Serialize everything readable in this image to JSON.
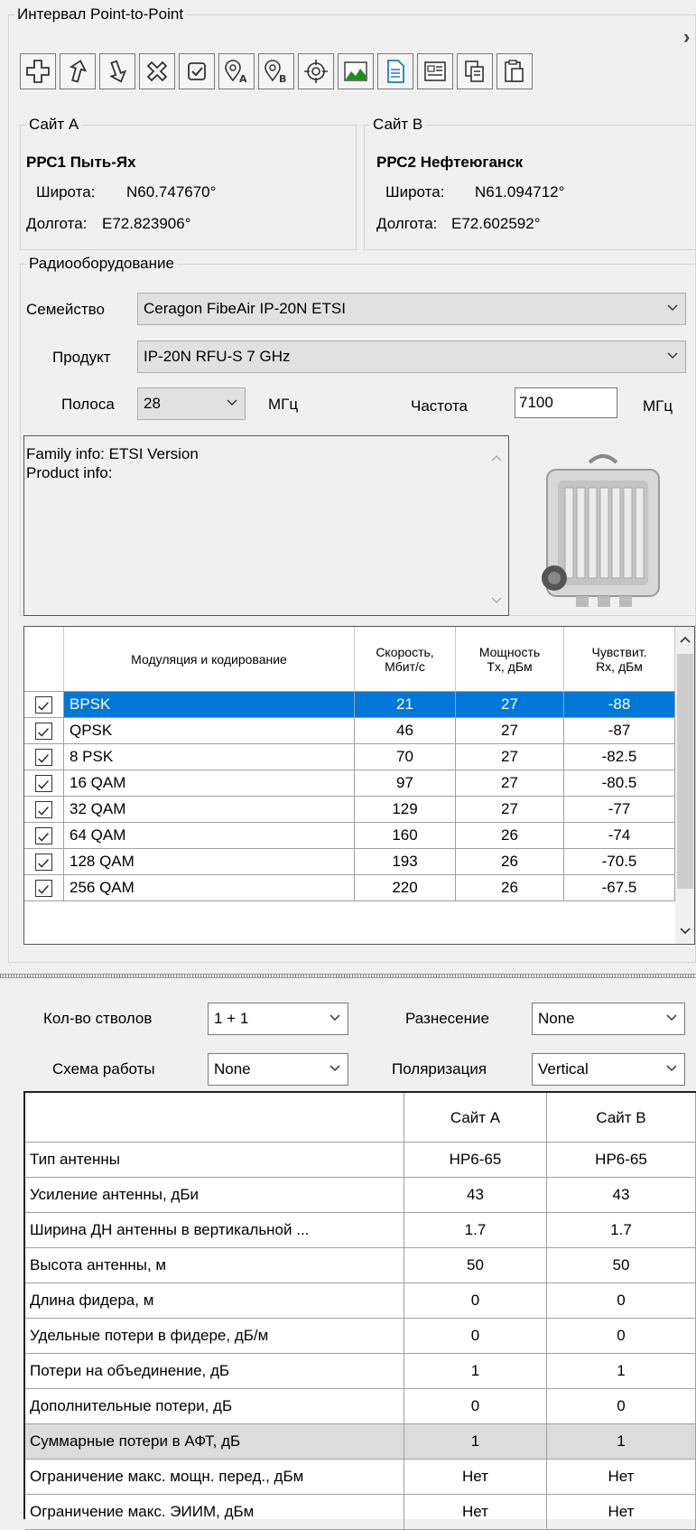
{
  "panel": {
    "title": "Интервал Point-to-Point",
    "collapse_glyph": "›"
  },
  "toolbar": {
    "buttons": [
      {
        "name": "add-icon"
      },
      {
        "name": "move-up-icon"
      },
      {
        "name": "move-down-icon"
      },
      {
        "name": "delete-icon"
      },
      {
        "name": "check-icon"
      },
      {
        "name": "site-a-pin-icon"
      },
      {
        "name": "site-b-pin-icon"
      },
      {
        "name": "target-icon"
      },
      {
        "name": "profile-chart-icon"
      },
      {
        "name": "document-icon"
      },
      {
        "name": "report-icon"
      },
      {
        "name": "copy-icon"
      },
      {
        "name": "paste-icon"
      }
    ]
  },
  "site_a": {
    "legend": "Сайт А",
    "name": "РРС1 Пыть-Ях",
    "lat_label": "Широта:",
    "lat_value": "N60.747670°",
    "lon_label": "Долгота:",
    "lon_value": "E72.823906°"
  },
  "site_b": {
    "legend": "Сайт В",
    "name": "РРС2 Нефтеюганск",
    "lat_label": "Широта:",
    "lat_value": "N61.094712°",
    "lon_label": "Долгота:",
    "lon_value": "E72.602592°"
  },
  "radio": {
    "legend": "Радиооборудование",
    "family_label": "Семейство",
    "family_value": "Ceragon FibeAir IP-20N ETSI",
    "product_label": "Продукт",
    "product_value": "IP-20N RFU-S 7 GHz",
    "band_label": "Полоса",
    "band_value": "28",
    "band_unit": "МГц",
    "freq_label": "Частота",
    "freq_value": "7100",
    "freq_unit": "МГц",
    "info_line1": "Family info: ETSI Version",
    "info_line2": "Product info:"
  },
  "modulation_table": {
    "headers": {
      "mod": "Модуляция и кодирование",
      "speed1": "Скорость,",
      "speed2": "Мбит/с",
      "power1": "Мощность",
      "power2": "Tx, дБм",
      "sens1": "Чувствит.",
      "sens2": "Rx, дБм"
    },
    "rows": [
      {
        "mod": "BPSK",
        "speed": "21",
        "power": "27",
        "sens": "-88",
        "checked": true,
        "selected": true
      },
      {
        "mod": "QPSK",
        "speed": "46",
        "power": "27",
        "sens": "-87",
        "checked": true
      },
      {
        "mod": "8 PSK",
        "speed": "70",
        "power": "27",
        "sens": "-82.5",
        "checked": true
      },
      {
        "mod": "16 QAM",
        "speed": "97",
        "power": "27",
        "sens": "-80.5",
        "checked": true
      },
      {
        "mod": "32 QAM",
        "speed": "129",
        "power": "27",
        "sens": "-77",
        "checked": true
      },
      {
        "mod": "64 QAM",
        "speed": "160",
        "power": "26",
        "sens": "-74",
        "checked": true
      },
      {
        "mod": "128 QAM",
        "speed": "193",
        "power": "26",
        "sens": "-70.5",
        "checked": true
      },
      {
        "mod": "256 QAM",
        "speed": "220",
        "power": "26",
        "sens": "-67.5",
        "checked": true
      }
    ]
  },
  "config": {
    "trunks_label": "Кол-во стволов",
    "trunks_value": "1 + 1",
    "diversity_label": "Разнесение",
    "diversity_value": "None",
    "scheme_label": "Схема работы",
    "scheme_value": "None",
    "polarization_label": "Поляризация",
    "polarization_value": "Vertical"
  },
  "antenna_table": {
    "headers": {
      "param": "",
      "site_a": "Сайт А",
      "site_b": "Сайт В"
    },
    "rows": [
      {
        "param": "Тип антенны",
        "a": "HP6-65",
        "b": "HP6-65"
      },
      {
        "param": "Усиление антенны, дБи",
        "a": "43",
        "b": "43"
      },
      {
        "param": "Ширина ДН антенны в вертикальной ...",
        "a": "1.7",
        "b": "1.7"
      },
      {
        "param": "Высота антенны, м",
        "a": "50",
        "b": "50"
      },
      {
        "param": "Длина фидера, м",
        "a": "0",
        "b": "0"
      },
      {
        "param": "Удельные потери в фидере, дБ/м",
        "a": "0",
        "b": "0"
      },
      {
        "param": "Потери на объединение, дБ",
        "a": "1",
        "b": "1"
      },
      {
        "param": "Дополнительные потери, дБ",
        "a": "0",
        "b": "0"
      },
      {
        "param": "Суммарные потери в АФТ, дБ",
        "a": "1",
        "b": "1",
        "gray": true
      },
      {
        "param": "Ограничение макс. мощн. перед., дБм",
        "a": "Нет",
        "b": "Нет"
      },
      {
        "param": "Ограничение макс. ЭИИМ, дБм",
        "a": "Нет",
        "b": "Нет"
      }
    ]
  },
  "colors": {
    "selection": "#0078d7",
    "accent_green": "#1a8f1a",
    "doc_blue": "#1e78d2"
  }
}
